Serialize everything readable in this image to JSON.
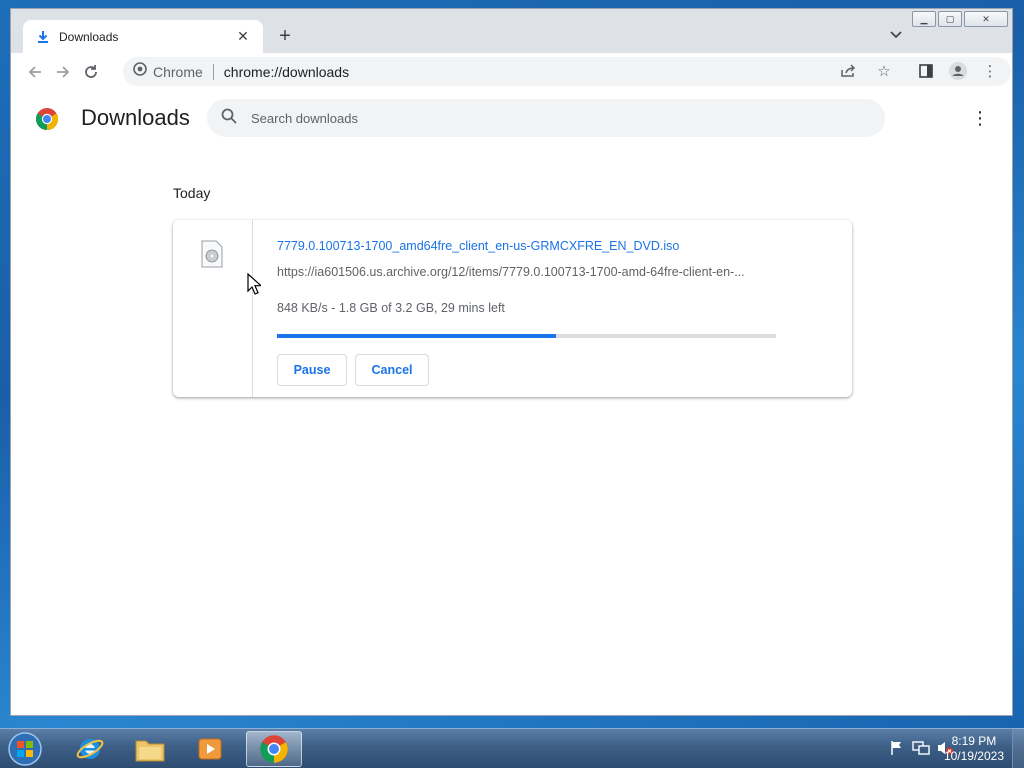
{
  "browser": {
    "tab_title": "Downloads",
    "omnibox_label": "Chrome",
    "omnibox_url": "chrome://downloads"
  },
  "downloads_page": {
    "title": "Downloads",
    "search_placeholder": "Search downloads",
    "section_date": "Today",
    "items": [
      {
        "file_name": "7779.0.100713-1700_amd64fre_client_en-us-GRMCXFRE_EN_DVD.iso",
        "source_url": "https://ia601506.us.archive.org/12/items/7779.0.100713-1700-amd-64fre-client-en-...",
        "status": "848 KB/s - 1.8 GB of 3.2 GB, 29 mins left",
        "progress_fraction": 0.56,
        "pause_label": "Pause",
        "cancel_label": "Cancel"
      }
    ]
  },
  "taskbar": {
    "clock_time": "8:19 PM",
    "clock_date": "10/19/2023",
    "apps": [
      "start-orb",
      "internet-explorer-icon",
      "windows-explorer-icon",
      "media-player-icon",
      "chrome-icon"
    ]
  },
  "colors": {
    "accent": "#1a73e8",
    "page_bg": "#ffffff",
    "tabstrip_bg": "#dee1e6"
  }
}
